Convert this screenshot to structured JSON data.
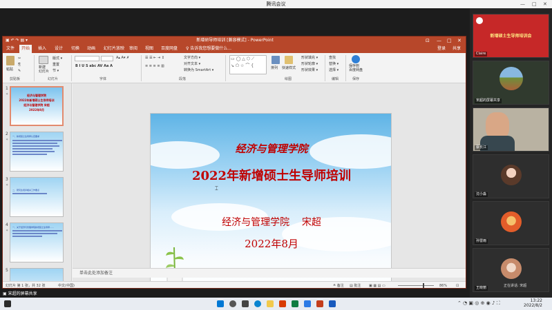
{
  "meeting": {
    "title": "腾讯会议",
    "controls": [
      "—",
      "□",
      "✕"
    ]
  },
  "ppt": {
    "title": "新增研导师培训 [兼容模式] - PowerPoint",
    "quick_access": "▣ ↶ ↷ ▤ ▾",
    "window_controls": [
      "⊡",
      "—",
      "□",
      "✕"
    ],
    "tabs": [
      "文件",
      "开始",
      "插入",
      "设计",
      "切换",
      "动画",
      "幻灯片放映",
      "审阅",
      "视图",
      "百度网盘",
      "♀ 告诉我您想要做什么..."
    ],
    "active_tab": "开始",
    "account": "登录",
    "share": "共享",
    "ribbon": {
      "groups": [
        "剪贴板",
        "幻灯片",
        "字体",
        "段落",
        "绘图",
        "编辑",
        "保存"
      ],
      "paste": "粘贴",
      "new_slide": "新建\n幻灯片",
      "layout": "版式 ▾",
      "reset": "重置",
      "section": "节 ▾",
      "arrange": "排列",
      "quick_styles": "快速样式",
      "text_direction": "文字方向 ▾",
      "align_text": "对齐文本 ▾",
      "smartart": "转换为 SmartArt ▾",
      "shape_fill": "形状填充 ▾",
      "shape_outline": "形状轮廓 ▾",
      "shape_effects": "形状效果 ▾",
      "find": "查找",
      "replace": "替换 ▾",
      "select": "选择 ▾",
      "save_to": "保存到\n百度网盘"
    },
    "thumbnails": [
      {
        "num": "1",
        "lines": [
          "经济与管理学院",
          "2022年新增硕士生导师培训",
          "经济与管理学院 宋超",
          "2022年8月"
        ]
      },
      {
        "num": "2",
        "lines": [
          "一、新增硕士生导师认定要求",
          "……"
        ]
      },
      {
        "num": "3",
        "lines": [
          "二、研究生培养相关工作要点"
        ]
      },
      {
        "num": "4",
        "lines": [
          "一、关于经济与管理学院新增硕士生导师……"
        ]
      },
      {
        "num": "5",
        "lines": []
      }
    ],
    "slide": {
      "school": "经济与管理学院",
      "training": "2022年新增硕士生导师培训",
      "presenter": "经济与管理学院    宋超",
      "date": "2022年8月"
    },
    "notes_placeholder": "单击此处添加备注",
    "status": {
      "slide_count": "幻灯片 第 1 张，共 32 张",
      "language": "中文(中国)",
      "notes_btn": "≙ 备注",
      "comments_btn": "▤ 批注",
      "zoom": "86%"
    }
  },
  "participants": [
    {
      "name": "Claire",
      "kind": "shared-slide",
      "banner": "新增硕士生导师培训会"
    },
    {
      "name": "宋超的屏幕共享",
      "kind": "landscape"
    },
    {
      "name": "蔡长江",
      "kind": "camera"
    },
    {
      "name": "沈小淼",
      "kind": "avatar"
    },
    {
      "name": "孙雷雨",
      "kind": "avatar"
    },
    {
      "name": "王晓丽",
      "kind": "avatar"
    }
  ],
  "speaking": "正在讲话: 宋超",
  "share_indicator": "宋超的屏幕共享",
  "taskbar": {
    "time": "13:22",
    "date": "2022/8/2"
  },
  "colors": {
    "ppt_accent": "#b7472a",
    "title_red": "#c00000"
  }
}
